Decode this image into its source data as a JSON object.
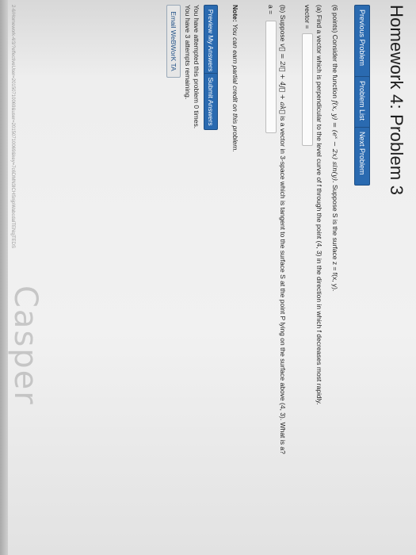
{
  "page": {
    "title": "Homework 4: Problem 3"
  },
  "nav": {
    "previous": "Previous Problem",
    "list": "Problem List",
    "next": "Next Problem"
  },
  "problem": {
    "intro_prefix": "(6 points) Consider the function",
    "function": "f(x, y) = (eˣ − 2x) sin(y).",
    "intro_suffix": "Suppose S is the surface z = f(x, y).",
    "part_a": "(a) Find a vector which is perpendicular to the level curve of f through the point (4, 3) in the direction in which f decreases most rapidly.",
    "vector_label": "vector =",
    "part_b_prefix": "(b) Suppose",
    "part_b_vector": "v⃗ = 2i⃗ + 4j⃗ + ak⃗",
    "part_b_suffix": "is a vector in 3-space which is tangent to the surface S at the point P lying on the surface above (4, 3). What is a?",
    "a_label": "a ="
  },
  "note": {
    "label": "Note:",
    "text": "You can earn partial credit on this problem."
  },
  "actions": {
    "preview": "Preview My Answers",
    "submit": "Submit Answers"
  },
  "attempts": {
    "line1": "You have attempted this problem 0 times.",
    "line2": "You have 3 attempts remaining."
  },
  "email": {
    "label": "Email WeBWorK TA"
  },
  "footer": {
    "url": "2-6/Homework-4/3/?effectiveUser=20150710069&user=20150710069&key=7c6DMN3ICHSnjpWabcdalTENqjTEDS"
  },
  "watermark": {
    "text": "Casper"
  }
}
